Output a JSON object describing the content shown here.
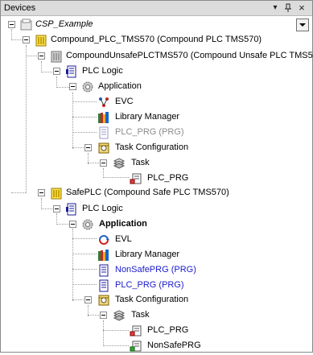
{
  "window": {
    "title": "Devices",
    "close_glyph": "×"
  },
  "tree": {
    "root": {
      "label": "CSP_Example",
      "icon": "project-icon"
    },
    "compound_plc": {
      "label": "Compound_PLC_TMS570 (Compound PLC TMS570)",
      "icon": "plc-device-icon"
    },
    "unsafe_plc": {
      "label": "CompoundUnsafePLCTMS570 (Compound Unsafe PLC TMS570)",
      "icon": "unsafe-plc-device-icon"
    },
    "plc_logic_1": {
      "label": "PLC Logic",
      "icon": "plc-logic-icon"
    },
    "application_1": {
      "label": "Application",
      "icon": "application-gear-icon"
    },
    "evc": {
      "label": "EVC",
      "icon": "evc-icon"
    },
    "library_manager_1": {
      "label": "Library Manager",
      "icon": "library-manager-icon"
    },
    "plc_prg_1": {
      "label": "PLC_PRG (PRG)",
      "icon": "program-icon"
    },
    "task_config_1": {
      "label": "Task Configuration",
      "icon": "task-configuration-icon"
    },
    "task_1": {
      "label": "Task",
      "icon": "task-icon"
    },
    "task_1_plc_prg": {
      "label": "PLC_PRG",
      "icon": "program-call-icon"
    },
    "safe_plc": {
      "label": "SafePLC (Compound Safe PLC TMS570)",
      "icon": "safe-plc-device-icon"
    },
    "plc_logic_2": {
      "label": "PLC Logic",
      "icon": "plc-logic-icon"
    },
    "application_2": {
      "label": "Application",
      "icon": "application-gear-icon"
    },
    "evl": {
      "label": "EVL",
      "icon": "evl-icon"
    },
    "library_manager_2": {
      "label": "Library Manager",
      "icon": "library-manager-icon"
    },
    "nonsafe_prg": {
      "label": "NonSafePRG (PRG)",
      "icon": "program-icon"
    },
    "plc_prg_2": {
      "label": "PLC_PRG (PRG)",
      "icon": "program-icon"
    },
    "task_config_2": {
      "label": "Task Configuration",
      "icon": "task-configuration-icon"
    },
    "task_2": {
      "label": "Task",
      "icon": "task-icon"
    },
    "task_2_plc_prg": {
      "label": "PLC_PRG",
      "icon": "program-call-icon"
    },
    "task_2_nonsafe": {
      "label": "NonSafePRG",
      "icon": "program-call-icon"
    }
  },
  "colors": {
    "title_bar": "#dcdcdc",
    "link_blue": "#1a1acc",
    "disabled_gray": "#8c8c8c"
  }
}
